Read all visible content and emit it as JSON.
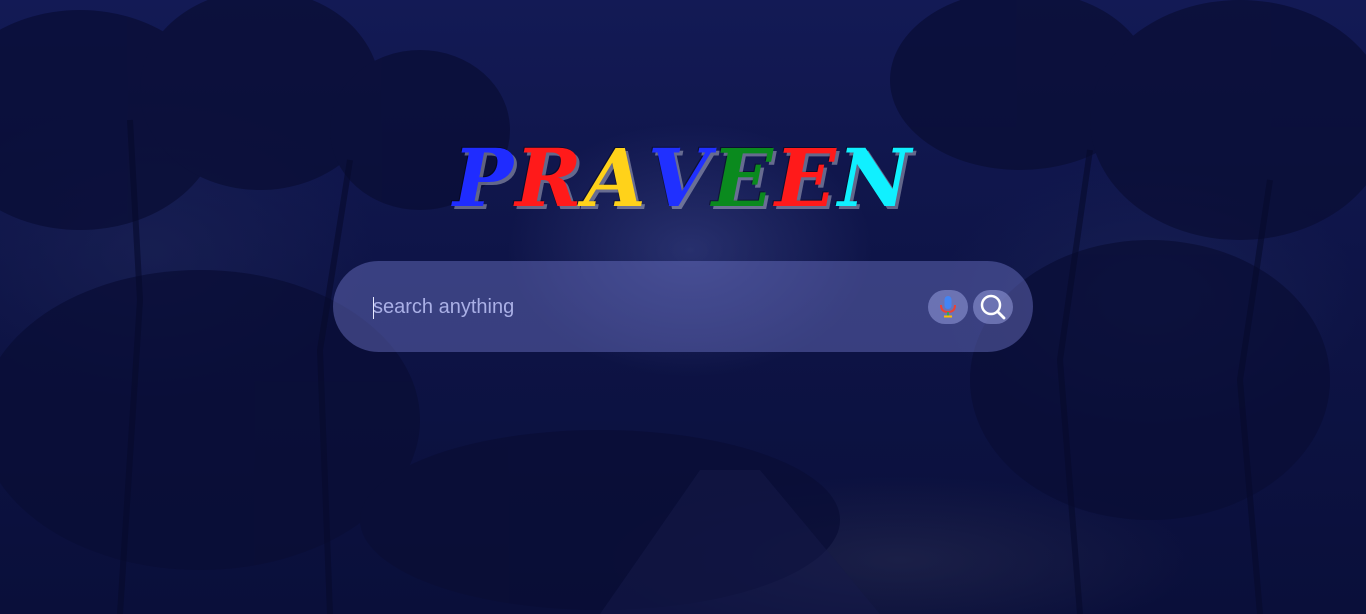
{
  "logo": {
    "letters": [
      {
        "char": "P",
        "color": "#1f2cff"
      },
      {
        "char": "R",
        "color": "#ff1a1a"
      },
      {
        "char": "A",
        "color": "#ffd21a"
      },
      {
        "char": "V",
        "color": "#2030ff"
      },
      {
        "char": "E",
        "color": "#0a8a1e"
      },
      {
        "char": "E",
        "color": "#ff1a1a"
      },
      {
        "char": "N",
        "color": "#10f0ff"
      }
    ]
  },
  "search": {
    "placeholder": "search anything",
    "value": "",
    "mic_icon": "microphone-icon",
    "search_icon": "magnifier-icon"
  },
  "colors": {
    "background": "#0c1140",
    "search_bar": "#4b4f96"
  }
}
